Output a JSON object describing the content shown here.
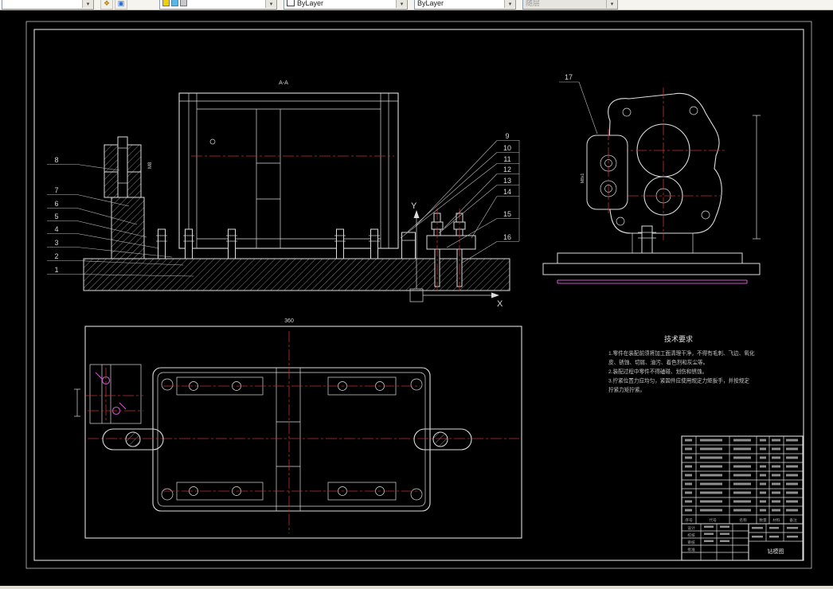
{
  "toolbar": {
    "color_value": "ByLayer",
    "linetype_value": "ByLayer",
    "plotstyle_value": "随层"
  },
  "drawing": {
    "section_label": "A-A",
    "axis_x": "X",
    "axis_y": "Y",
    "dim_plan_width": "360",
    "thread_left": "M8",
    "thread_side": "M8x1",
    "side_callout": "17",
    "callouts_left": [
      "8",
      "7",
      "6",
      "5",
      "4",
      "3",
      "2",
      "1"
    ],
    "callouts_right": [
      "9",
      "10",
      "11",
      "12",
      "13",
      "14",
      "15",
      "16"
    ]
  },
  "tech_req": {
    "title": "技术要求",
    "lines": [
      "1.零件在装配前须将加工面清理干净，不得有毛刺、飞边、氧化",
      "皮、锈蚀、切屑、油污、着色剂和灰尘等。",
      "2.装配过程中零件不得磕碰、划伤和锈蚀。",
      "3.拧紧位置力应均匀，紧固件应使用规定力矩扳手，并按规定",
      "拧紧力矩拧紧。"
    ]
  },
  "title_block": {
    "parts_header": [
      "序号",
      "代号",
      "名称",
      "数量",
      "材料",
      "备注"
    ],
    "left_labels": [
      "设计",
      "校核",
      "审核",
      "批准"
    ],
    "drawing_name": "钻模图"
  }
}
